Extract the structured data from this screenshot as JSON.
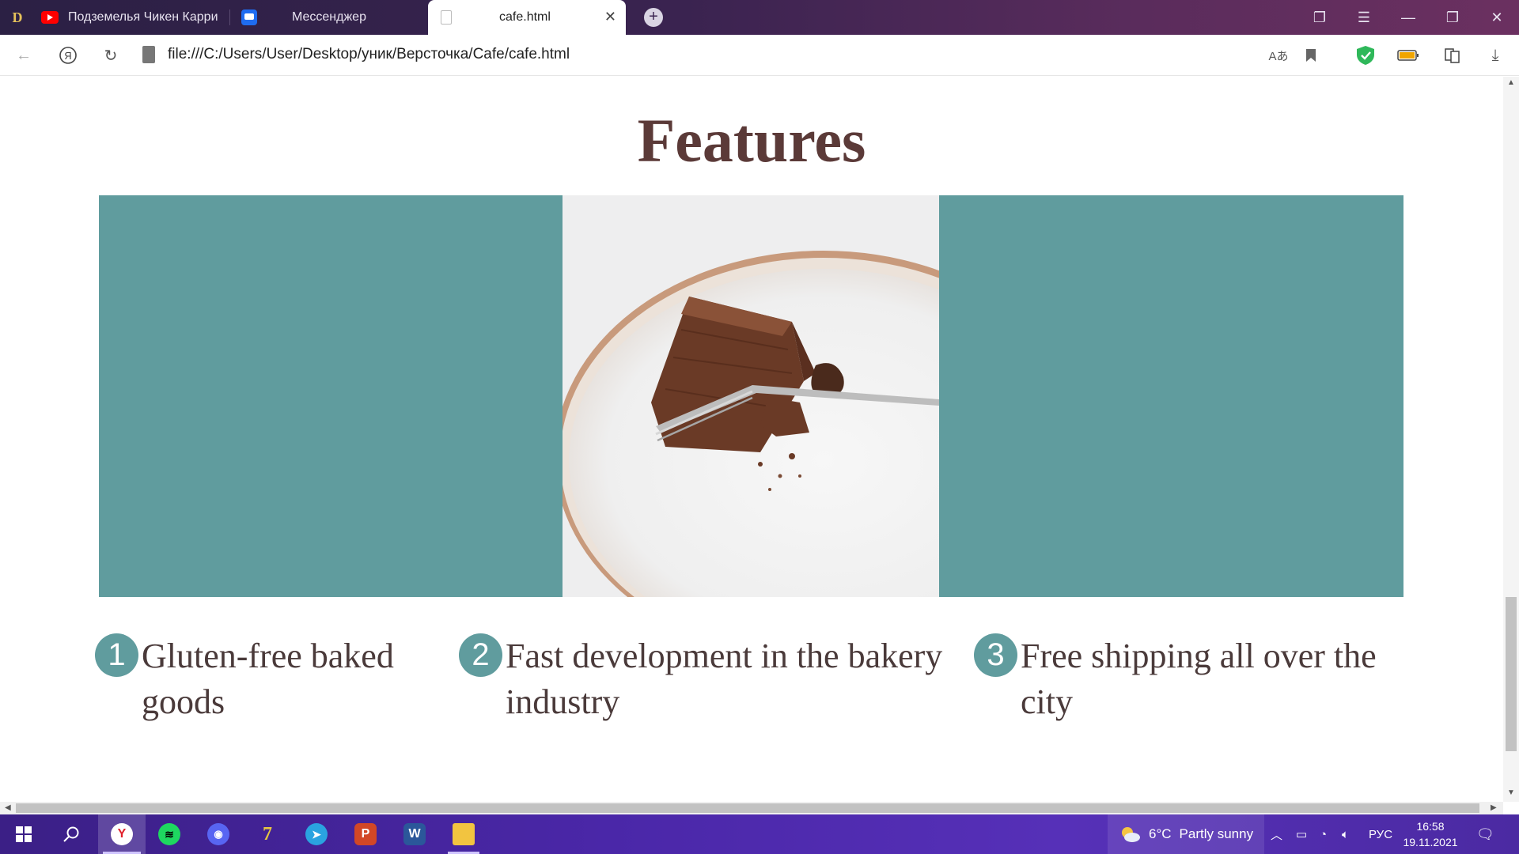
{
  "browser": {
    "tabs": [
      {
        "label": "Подземелья Чикен Карри",
        "favicon": "youtube-icon"
      },
      {
        "label": "Мессенджер",
        "favicon": "messenger-icon"
      },
      {
        "label": "cafe.html",
        "favicon": "file-icon"
      }
    ],
    "url": "file:///C:/Users/User/Desktop/уник/Версточка/Cafe/cafe.html"
  },
  "page": {
    "title": "Features",
    "accent_color": "#609c9e",
    "title_color": "#5b3a38",
    "features": [
      {
        "number": "1",
        "text": " Gluten-free baked goods"
      },
      {
        "number": "2",
        "text": "Fast development in the bakery industry"
      },
      {
        "number": "3",
        "text": "Free shipping all over the city"
      }
    ]
  },
  "taskbar": {
    "weather": {
      "temp": "6°C",
      "condition": "Partly sunny"
    },
    "language": "РУС",
    "time": "16:58",
    "date": "19.11.2021"
  }
}
